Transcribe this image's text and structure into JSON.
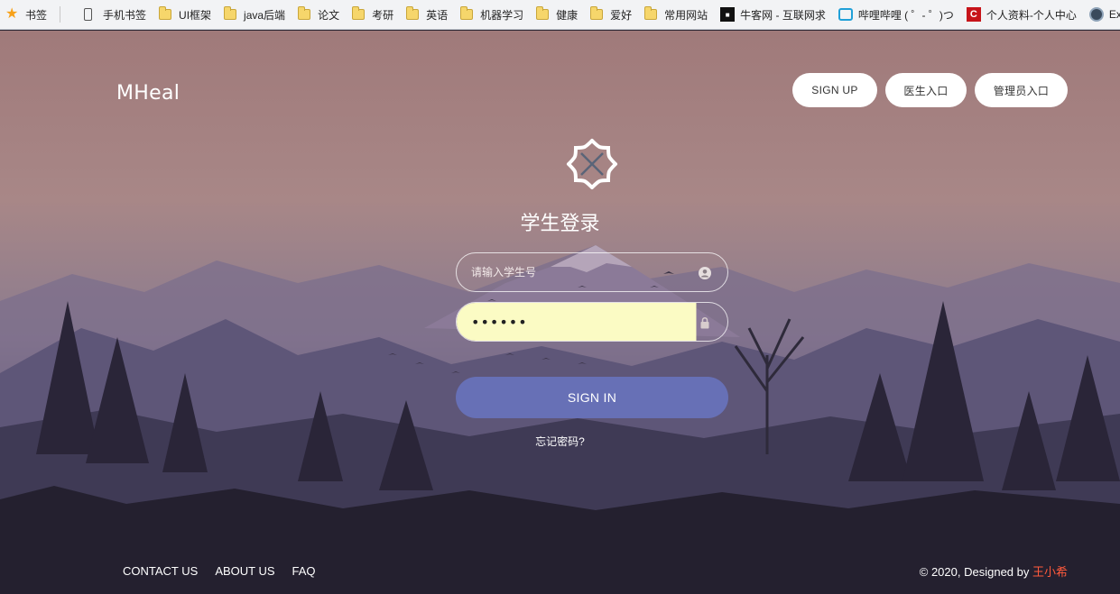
{
  "bookmarks": [
    {
      "label": "书签",
      "icon": "star-icon"
    },
    {
      "label": "手机书签",
      "icon": "phone-icon"
    },
    {
      "label": "UI框架",
      "icon": "folder-icon"
    },
    {
      "label": "java后端",
      "icon": "folder-icon"
    },
    {
      "label": "论文",
      "icon": "folder-icon"
    },
    {
      "label": "考研",
      "icon": "folder-icon"
    },
    {
      "label": "英语",
      "icon": "folder-icon"
    },
    {
      "label": "机器学习",
      "icon": "folder-icon"
    },
    {
      "label": "健康",
      "icon": "folder-icon"
    },
    {
      "label": "爱好",
      "icon": "folder-icon"
    },
    {
      "label": "常用网站",
      "icon": "folder-icon"
    },
    {
      "label": "牛客网 - 互联网求",
      "icon": "nowcoder-icon"
    },
    {
      "label": "哔哩哔哩 ( ゜- ゜)つ",
      "icon": "bilibili-icon"
    },
    {
      "label": "个人资料-个人中心",
      "icon": "csdn-icon"
    },
    {
      "label": "Explore",
      "icon": "explore-icon"
    }
  ],
  "header": {
    "brand": "MHeal",
    "signup_label": "SIGN UP",
    "doctor_label": "医生入口",
    "admin_label": "管理员入口"
  },
  "login": {
    "title": "学生登录",
    "student_id_placeholder": "请输入学生号",
    "password_value": "••••••",
    "signin_label": "SIGN IN",
    "forgot_label": "忘记密码?"
  },
  "footer": {
    "links": [
      "CONTACT US",
      "ABOUT US",
      "FAQ"
    ],
    "copyright_prefix": "© 2020, Designed by ",
    "author": "王小希"
  },
  "colors": {
    "signin_button": "#6770b6",
    "author_link": "#ff5a3c",
    "password_autofill": "#fbfbc4"
  }
}
